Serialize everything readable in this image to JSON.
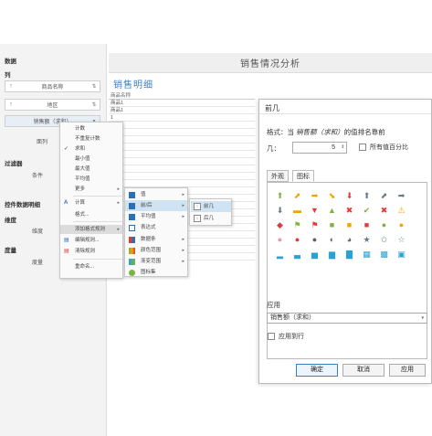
{
  "left_pane": {
    "data_section": "数据",
    "col_section": "列",
    "fields": [
      {
        "arrow": "↑",
        "label": "商品名称",
        "sort": "⇅"
      },
      {
        "arrow": "↑",
        "label": "地区",
        "sort": "⇅"
      },
      {
        "arrow": "",
        "label": "销售额（求和）",
        "sort": "▾"
      }
    ],
    "col_label": "面列",
    "filter_section": "过滤器",
    "filter_label": "条件",
    "extra_section": "控件数据明细",
    "dim_section": "维度",
    "dim_label": "维度",
    "measure_section": "度量",
    "measure_label": "度量"
  },
  "header": {
    "title": "销售情况分析"
  },
  "detail": {
    "title": "销售明细"
  },
  "table": {
    "column": "商品名称",
    "rows": [
      "商品1",
      "商品1",
      "1",
      "1",
      "1",
      "1",
      "1",
      "1",
      "1",
      "1",
      "1",
      "1",
      "1",
      "1",
      "1",
      "1",
      "1",
      "1",
      "1",
      "1",
      "1",
      "1"
    ]
  },
  "context_menu": {
    "items": [
      {
        "label": "计数",
        "check": "",
        "sub": ""
      },
      {
        "label": "不重复计数",
        "check": "",
        "sub": ""
      },
      {
        "label": "求和",
        "check": "✓",
        "sub": ""
      },
      {
        "label": "最小值",
        "check": "",
        "sub": ""
      },
      {
        "label": "最大值",
        "check": "",
        "sub": ""
      },
      {
        "label": "平均值",
        "check": "",
        "sub": ""
      },
      {
        "label": "更多",
        "check": "",
        "sub": "▸"
      },
      {
        "label": "计算",
        "check": "A",
        "sub": "▸"
      },
      {
        "label": "格式...",
        "check": "",
        "sub": ""
      },
      {
        "label": "添加格式规则",
        "check": "",
        "sub": "▸"
      },
      {
        "label": "编辑规则...",
        "check": "",
        "sub": ""
      },
      {
        "label": "清除规则",
        "check": "",
        "sub": ""
      },
      {
        "label": "重命名...",
        "check": "",
        "sub": ""
      }
    ]
  },
  "submenu1": {
    "items": [
      {
        "label": "值",
        "sub": "▸"
      },
      {
        "label": "前/后",
        "sub": "▸"
      },
      {
        "label": "平均值",
        "sub": "▸"
      },
      {
        "label": "表达式",
        "sub": ""
      },
      {
        "label": "数据条",
        "sub": "▸"
      },
      {
        "label": "颜色范围",
        "sub": "▸"
      },
      {
        "label": "渐变范围",
        "sub": "▸"
      },
      {
        "label": "图标集",
        "sub": ""
      }
    ]
  },
  "submenu2": {
    "items": [
      {
        "label": "前几",
        "icon": "↑"
      },
      {
        "label": "后几",
        "icon": "↓"
      }
    ]
  },
  "dialog": {
    "title": "前几",
    "format_prefix": "格式：当",
    "format_field": "销售额（求和）",
    "format_suffix": "的值排名靠前",
    "count_label": "几：",
    "count_value": "5",
    "count_spin": "⇕",
    "percent_label": "所有值百分比",
    "tabs": [
      "外观",
      "图标"
    ],
    "active_tab": "图标",
    "icon_rows": [
      [
        {
          "g": "⬆",
          "c": "#7cb342"
        },
        {
          "g": "⬈",
          "c": "#f0a400"
        },
        {
          "g": "➡",
          "c": "#f0a400"
        },
        {
          "g": "⬊",
          "c": "#f0a400"
        },
        {
          "g": "⬇",
          "c": "#e53935"
        },
        {
          "g": "⬆",
          "c": "#607d8b"
        },
        {
          "g": "⬈",
          "c": "#607d8b"
        },
        {
          "g": "➡",
          "c": "#607d8b"
        }
      ],
      [
        {
          "g": "⬇",
          "c": "#607d8b"
        },
        {
          "g": "▬",
          "c": "#f0a400"
        },
        {
          "g": "▼",
          "c": "#e53935"
        },
        {
          "g": "▲",
          "c": "#7cb342"
        },
        {
          "g": "✖",
          "c": "#e53935"
        },
        {
          "g": "✔",
          "c": "#7cb342"
        },
        {
          "g": "✖",
          "c": "#e53935"
        },
        {
          "g": "⚠",
          "c": "#f0a400"
        }
      ],
      [
        {
          "g": "◆",
          "c": "#e53935"
        },
        {
          "g": "⚑",
          "c": "#7cb342"
        },
        {
          "g": "⚑",
          "c": "#e53935"
        },
        {
          "g": "■",
          "c": "#7cb342"
        },
        {
          "g": "■",
          "c": "#f0a400"
        },
        {
          "g": "■",
          "c": "#e53935"
        },
        {
          "g": "●",
          "c": "#7cb342"
        },
        {
          "g": "●",
          "c": "#f0a400"
        }
      ],
      [
        {
          "g": "●",
          "c": "#f48fb1"
        },
        {
          "g": "●",
          "c": "#e53935"
        },
        {
          "g": "●",
          "c": "#616161"
        },
        {
          "g": "◐",
          "c": "#616161"
        },
        {
          "g": "◕",
          "c": "#616161"
        },
        {
          "g": "★",
          "c": "#607d8b"
        },
        {
          "g": "✩",
          "c": "#607d8b"
        },
        {
          "g": "☆",
          "c": "#607d8b"
        }
      ],
      [
        {
          "g": "▂",
          "c": "#29a3d6"
        },
        {
          "g": "▃",
          "c": "#29a3d6"
        },
        {
          "g": "▅",
          "c": "#29a3d6"
        },
        {
          "g": "▆",
          "c": "#29a3d6"
        },
        {
          "g": "▇",
          "c": "#29a3d6"
        },
        {
          "g": "▦",
          "c": "#29a3d6"
        },
        {
          "g": "▩",
          "c": "#29a3d6"
        },
        {
          "g": "▣",
          "c": "#29a3d6"
        }
      ]
    ],
    "apply_label": "应用",
    "apply_value": "销售额（求和）",
    "apply_dropdown": "▾",
    "row_label": "应用到行",
    "ok": "确定",
    "cancel": "取消",
    "apply_btn": "应用"
  }
}
